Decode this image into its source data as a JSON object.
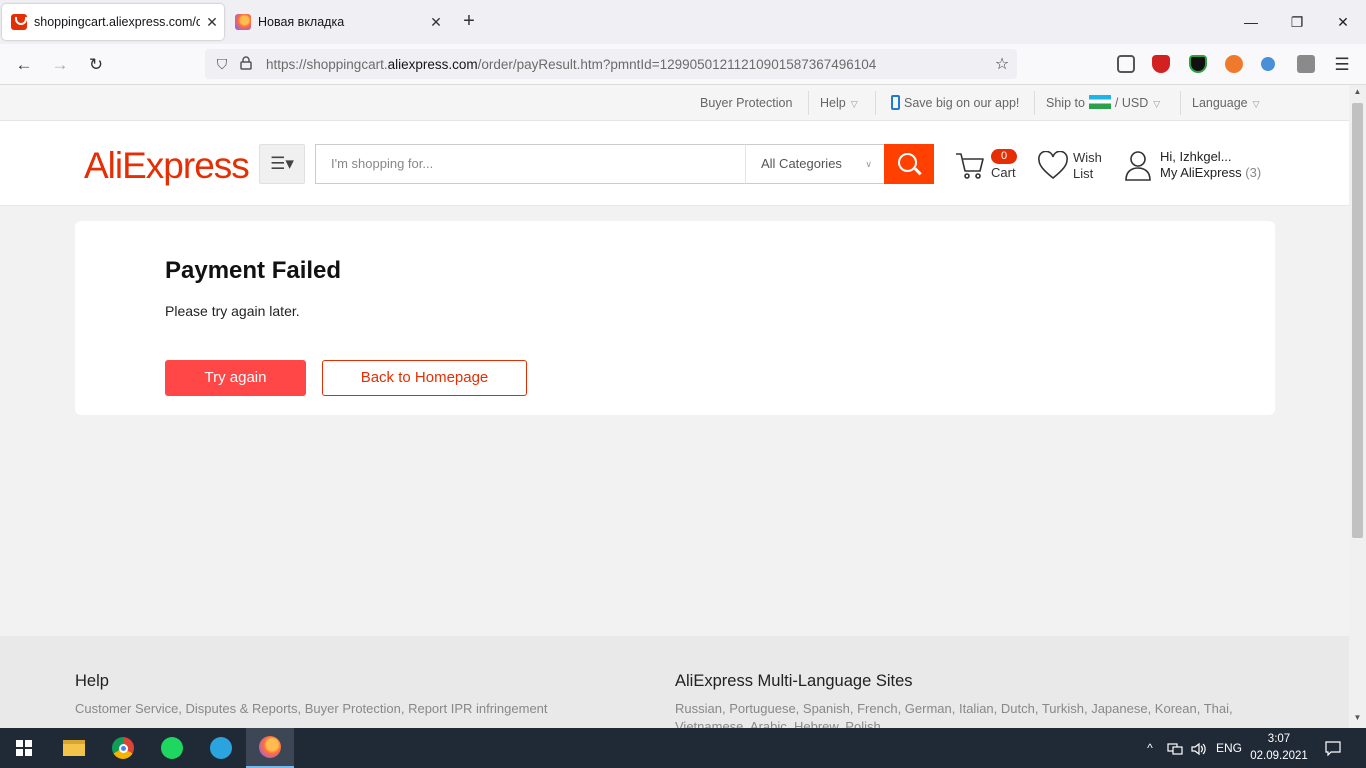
{
  "browser": {
    "tabs": [
      {
        "title": "shoppingcart.aliexpress.com/or",
        "active": true
      },
      {
        "title": "Новая вкладка",
        "active": false
      }
    ],
    "url": {
      "prefix": "https://shoppingcart.",
      "domain": "aliexpress.com",
      "path": "/order/payResult.htm?pmntId=129905012112109015873674961‌04"
    },
    "glyphs": {
      "close": "✕",
      "new_tab": "+",
      "minimize": "—",
      "restore": "❐",
      "window_close": "✕",
      "back": "←",
      "forward": "→",
      "reload": "↻",
      "shield": "⛉",
      "lock": "🔒",
      "star": "☆",
      "menu": "☰"
    }
  },
  "topbar": {
    "buyer_protection": "Buyer Protection",
    "help": "Help",
    "app_promo": "Save big on our app!",
    "ship_to": "Ship to",
    "slash": "/",
    "currency": "USD",
    "language": "Language"
  },
  "header": {
    "logo": "AliExpress",
    "category_menu_glyph": "☰▾",
    "search_placeholder": "I'm shopping for...",
    "category_select": "All Categories",
    "cart_count": "0",
    "cart_label": "Cart",
    "wish_line1": "Wish",
    "wish_line2": "List",
    "greeting": "Hi, Izhkgel...",
    "account_label": "My AliExpress",
    "account_count": "(3)"
  },
  "result": {
    "title": "Payment Failed",
    "message": "Please try again later.",
    "try_again": "Try again",
    "back_home": "Back to Homepage"
  },
  "footer": {
    "help_title": "Help",
    "help_links": "Customer Service, Disputes & Reports, Buyer Protection, Report IPR infringement",
    "lang_title": "AliExpress Multi-Language Sites",
    "lang_links": "Russian, Portuguese, Spanish, French, German, Italian, Dutch, Turkish, Japanese, Korean, Thai, Vietnamese, Arabic, Hebrew, Polish"
  },
  "taskbar": {
    "language": "ENG",
    "time": "3:07",
    "date": "02.09.2021",
    "chevron": "^"
  },
  "colors": {
    "brand": "#e62e04",
    "search_button": "#ff4000",
    "primary_button": "#ff4747"
  }
}
